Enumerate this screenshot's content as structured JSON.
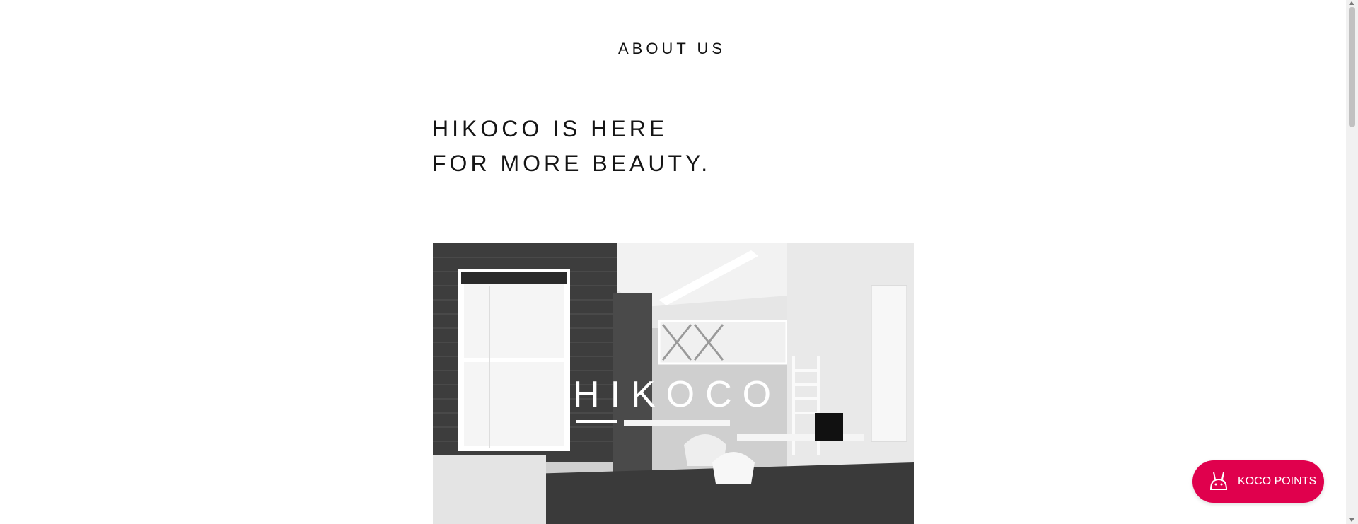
{
  "section": {
    "heading": "ABOUT US"
  },
  "hero": {
    "line1": "HIKOCO IS HERE",
    "line2": "FOR MORE BEAUTY."
  },
  "photo": {
    "logo_text": "HIKOCO"
  },
  "rewards": {
    "label": "KOCO POINTS",
    "icon": "bunny-icon",
    "color": "#e0004d"
  }
}
